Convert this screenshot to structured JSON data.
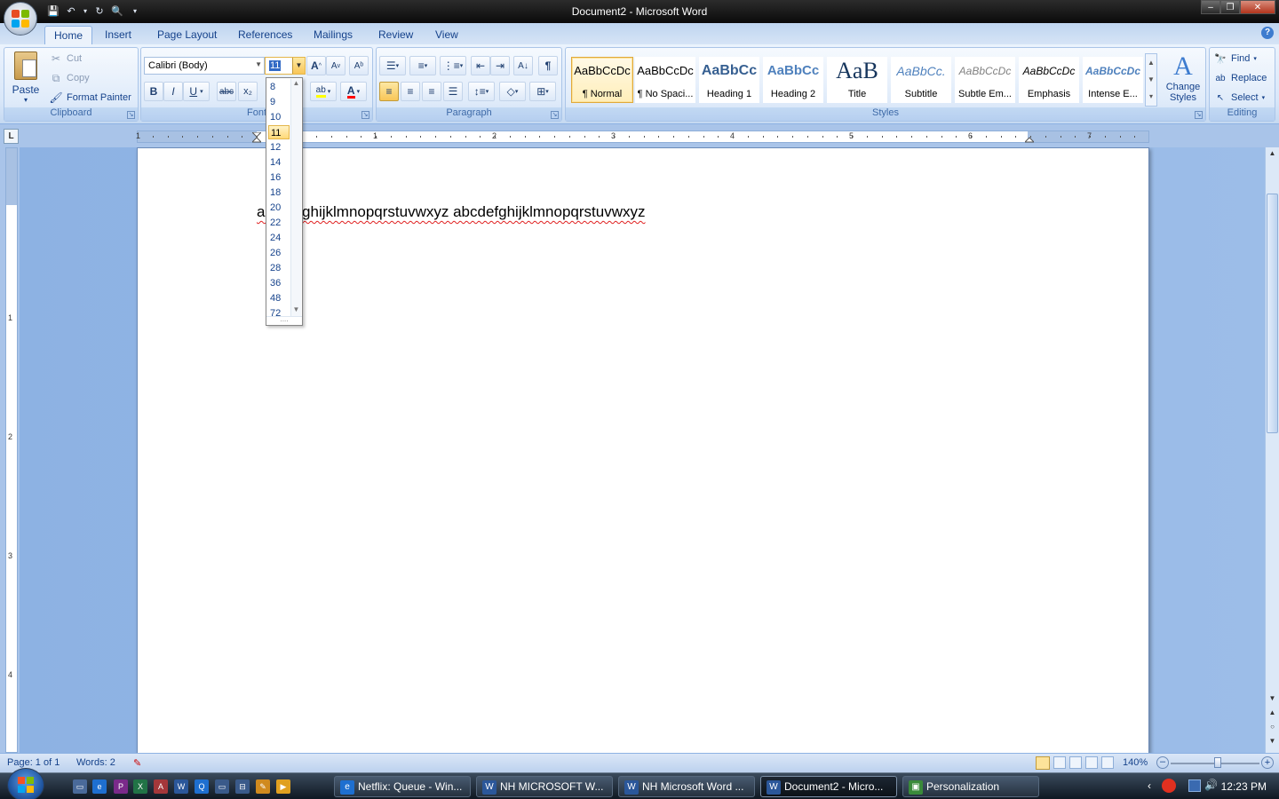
{
  "window": {
    "title": "Document2 - Microsoft Word",
    "controls": {
      "minimize": "–",
      "restore": "❐",
      "close": "✕"
    }
  },
  "quick_access": [
    "save-icon",
    "undo-icon",
    "redo-icon",
    "print-preview-icon",
    "customize-icon"
  ],
  "tabs": [
    "Home",
    "Insert",
    "Page Layout",
    "References",
    "Mailings",
    "Review",
    "View"
  ],
  "active_tab": "Home",
  "clipboard": {
    "paste": "Paste",
    "cut": "Cut",
    "copy": "Copy",
    "format_painter": "Format Painter",
    "label": "Clipboard"
  },
  "font": {
    "family": "Calibri (Body)",
    "size": "11",
    "label": "Font",
    "bold": "B",
    "italic": "I",
    "underline": "U",
    "strike": "abc",
    "subscript": "x₂",
    "grow": "A",
    "shrink": "A",
    "font_color": "A",
    "highlight": "ab"
  },
  "font_size_options": [
    "8",
    "9",
    "10",
    "11",
    "12",
    "14",
    "16",
    "18",
    "20",
    "22",
    "24",
    "26",
    "28",
    "36",
    "48",
    "72"
  ],
  "font_size_selected": "11",
  "paragraph": {
    "label": "Paragraph"
  },
  "styles": {
    "label": "Styles",
    "items": [
      {
        "preview": "AaBbCcDc",
        "name": "¶ Normal"
      },
      {
        "preview": "AaBbCcDc",
        "name": "¶ No Spaci..."
      },
      {
        "preview": "AaBbCc",
        "name": "Heading 1"
      },
      {
        "preview": "AaBbCc",
        "name": "Heading 2"
      },
      {
        "preview": "AaB",
        "name": "Title"
      },
      {
        "preview": "AaBbCc.",
        "name": "Subtitle"
      },
      {
        "preview": "AaBbCcDc",
        "name": "Subtle Em..."
      },
      {
        "preview": "AaBbCcDc",
        "name": "Emphasis"
      },
      {
        "preview": "AaBbCcDc",
        "name": "Intense E..."
      }
    ],
    "change_styles": "Change Styles"
  },
  "editing": {
    "label": "Editing",
    "find": "Find",
    "replace": "Replace",
    "select": "Select"
  },
  "ruler": {
    "numbers": [
      "1",
      "1",
      "2",
      "3",
      "4",
      "5",
      "6",
      "7"
    ],
    "vertical_numbers": [
      "1",
      "2",
      "3",
      "4"
    ],
    "tab_selector": "L"
  },
  "document": {
    "text": "abcdefghijklmnopqrstuvwxyz abcdefghijklmnopqrstuvwxyz"
  },
  "status": {
    "page": "Page: 1 of 1",
    "words": "Words: 2",
    "zoom": "140%"
  },
  "taskbar": {
    "tasks": [
      {
        "label": "Netflix: Queue - Win...",
        "color": "#1e6fd0",
        "icon": "e"
      },
      {
        "label": "NH MICROSOFT W...",
        "color": "#2b579a",
        "icon": "W"
      },
      {
        "label": "NH Microsoft Word ...",
        "color": "#2b579a",
        "icon": "W"
      },
      {
        "label": "Document2 - Micro...",
        "color": "#2b579a",
        "icon": "W"
      },
      {
        "label": "Personalization",
        "color": "#3a8a3a",
        "icon": "▣"
      }
    ],
    "time": "12:23 PM"
  }
}
